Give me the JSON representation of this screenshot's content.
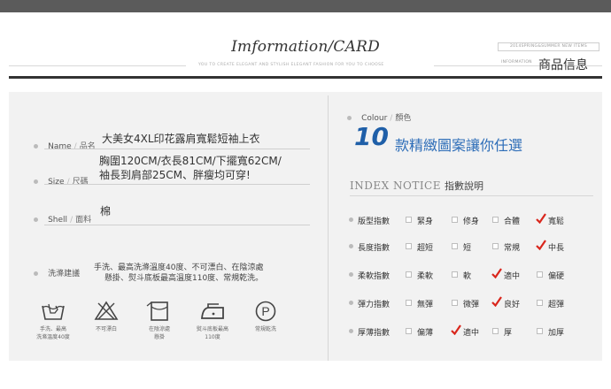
{
  "header": {
    "title": "Imformation/CARD",
    "subtitle": "YOU TO CREATE ELEGANT AND STYLISH ELEGANT FASHION FOR YOU TO CHOOSE",
    "season_tag": "2014SPRING&SUMMER NEW ITEMS",
    "info_small": "INFORMATION",
    "info_cn": "商品信息"
  },
  "left": {
    "name": {
      "label_en": "Name",
      "label_cn": "品名",
      "value": "大美女4XL印花露肩寬鬆短袖上衣"
    },
    "size": {
      "label_en": "Size",
      "label_cn": "尺碼",
      "value_line1": "胸圍120CM/衣長81CM/下擺寬62CM/",
      "value_line2": "袖長到肩部25CM、胖瘦均可穿!"
    },
    "shell": {
      "label_en": "Shell",
      "label_cn": "面料",
      "value": "棉"
    },
    "care": {
      "label": "洗滌建議",
      "line1": "手洗、最高洗滌溫度40度、不可漂白、在陰涼處",
      "line2": "懸掛、熨斗底板最高溫度110度、常規乾洗。"
    },
    "care_icons": [
      {
        "icon": "hand-wash-icon",
        "caption1": "手洗、最高",
        "caption2": "洗滌溫度40度"
      },
      {
        "icon": "no-bleach-icon",
        "caption1": "不可漂白",
        "caption2": ""
      },
      {
        "icon": "line-dry-shade-icon",
        "caption1": "在陰涼處",
        "caption2": "懸掛"
      },
      {
        "icon": "iron-icon",
        "caption1": "熨斗底板最高",
        "caption2": "110度"
      },
      {
        "icon": "dry-clean-icon",
        "caption1": "常規乾洗",
        "caption2": "",
        "symbol": "P"
      }
    ]
  },
  "right": {
    "colour": {
      "label_en": "Colour",
      "label_cn": "顏色",
      "number": "10",
      "text": "款精緻圖案讓你任選"
    },
    "index": {
      "title_en": "INDEX NOTICE",
      "title_cn": "指數說明"
    },
    "rows": [
      {
        "name": "版型指數",
        "options": [
          {
            "label": "緊身",
            "checked": false
          },
          {
            "label": "修身",
            "checked": false
          },
          {
            "label": "合體",
            "checked": false
          },
          {
            "label": "寬鬆",
            "checked": true
          }
        ]
      },
      {
        "name": "長度指數",
        "options": [
          {
            "label": "超短",
            "checked": false
          },
          {
            "label": "短",
            "checked": false
          },
          {
            "label": "常規",
            "checked": false
          },
          {
            "label": "中長",
            "checked": true
          }
        ]
      },
      {
        "name": "柔軟指數",
        "options": [
          {
            "label": "柔軟",
            "checked": false
          },
          {
            "label": "軟",
            "checked": false
          },
          {
            "label": "適中",
            "checked": true
          },
          {
            "label": "偏硬",
            "checked": false
          }
        ]
      },
      {
        "name": "彈力指數",
        "options": [
          {
            "label": "無彈",
            "checked": false
          },
          {
            "label": "微彈",
            "checked": false
          },
          {
            "label": "良好",
            "checked": true
          },
          {
            "label": "超彈",
            "checked": false
          }
        ]
      },
      {
        "name": "厚薄指數",
        "options": [
          {
            "label": "偏薄",
            "checked": false
          },
          {
            "label": "適中",
            "checked": true
          },
          {
            "label": "厚",
            "checked": false
          },
          {
            "label": "加厚",
            "checked": false
          }
        ]
      }
    ]
  },
  "colors": {
    "accent_blue": "#1f5fa8",
    "check_red": "#d9261c",
    "panel_bg": "#f2f2f2"
  }
}
